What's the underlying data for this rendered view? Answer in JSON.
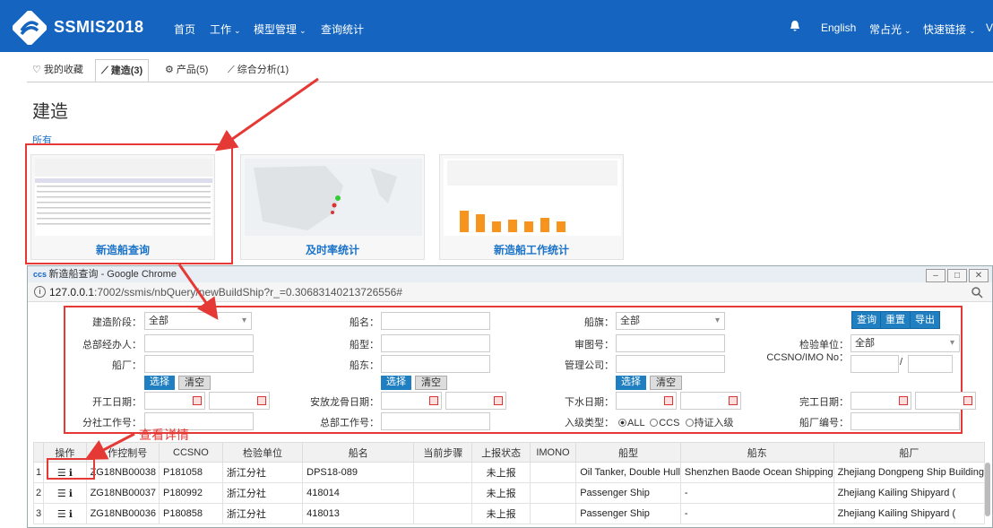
{
  "topnav": {
    "brand": "SSMIS2018",
    "items": [
      "首页",
      "工作",
      "模型管理",
      "查询统计"
    ],
    "right": [
      "English",
      "常占光",
      "快速链接",
      "V"
    ],
    "color": "#1565c0"
  },
  "tabs": [
    {
      "icon": "heart-icon",
      "label": "我的收藏"
    },
    {
      "icon": "line-chart-icon",
      "label": "建造(3)"
    },
    {
      "icon": "gears-icon",
      "label": "产品(5)"
    },
    {
      "icon": "line-chart-icon",
      "label": "综合分析(1)"
    }
  ],
  "page": {
    "title": "建造",
    "all_link": "所有"
  },
  "cards": [
    {
      "label": "新造船查询"
    },
    {
      "label": "及时率统计"
    },
    {
      "label": "新造船工作统计"
    }
  ],
  "browser": {
    "window_title": "新造船查询 - Google Chrome",
    "url_host": "127.0.0.1",
    "url_rest": ":7002/ssmis/nbQuery/newBuildShip?r_=0.30683140213726556#"
  },
  "form": {
    "labels": {
      "stage": "建造阶段：",
      "name": "船名：",
      "flag": "船旗：",
      "hq_handler": "总部经办人：",
      "type": "船型：",
      "drawing": "审图号：",
      "inspector": "检验单位：",
      "yard": "船厂：",
      "owner": "船东：",
      "mgmt": "管理公司：",
      "ccsno": "CCSNO/IMO No：",
      "start": "开工日期：",
      "keel": "安放龙骨日期：",
      "launch": "下水日期：",
      "complete": "完工日期：",
      "branch_no": "分社工作号：",
      "hq_no": "总部工作号：",
      "class_type": "入级类型：",
      "yard_no": "船厂编号："
    },
    "values": {
      "stage": "全部",
      "flag": "全部",
      "inspector": "全部",
      "ccsno_sep": "/"
    },
    "buttons": {
      "query": "查询",
      "reset": "重置",
      "export": "导出",
      "select": "选择",
      "clear": "清空"
    },
    "class_options": [
      "ALL",
      "CCS",
      "持证入级"
    ]
  },
  "annotation": "查看详情",
  "table": {
    "headers": [
      "操作",
      "工作控制号",
      "CCSNO",
      "检验单位",
      "船名",
      "当前步骤",
      "上报状态",
      "IMONO",
      "船型",
      "船东",
      "船厂"
    ],
    "rows": [
      {
        "n": "1",
        "ctrl": "ZG18NB00038",
        "ccsno": "P181058",
        "unit": "浙江分社",
        "name": "DPS18-089",
        "step": "",
        "status": "未上报",
        "imo": "",
        "type": "Oil Tanker, Double Hull",
        "owner": "Shenzhen Baode Ocean Shipping",
        "yard": "Zhejiang Dongpeng Ship Building"
      },
      {
        "n": "2",
        "ctrl": "ZG18NB00037",
        "ccsno": "P180992",
        "unit": "浙江分社",
        "name": "418014",
        "step": "",
        "status": "未上报",
        "imo": "",
        "type": "Passenger Ship",
        "owner": "-",
        "yard": "Zhejiang Kailing Shipyard ("
      },
      {
        "n": "3",
        "ctrl": "ZG18NB00036",
        "ccsno": "P180858",
        "unit": "浙江分社",
        "name": "418013",
        "step": "",
        "status": "未上报",
        "imo": "",
        "type": "Passenger Ship",
        "owner": "-",
        "yard": "Zhejiang Kailing Shipyard ("
      }
    ]
  },
  "colors": {
    "highlight": "#e53935",
    "link": "#1a73c8",
    "button": "#1f7fc0"
  }
}
